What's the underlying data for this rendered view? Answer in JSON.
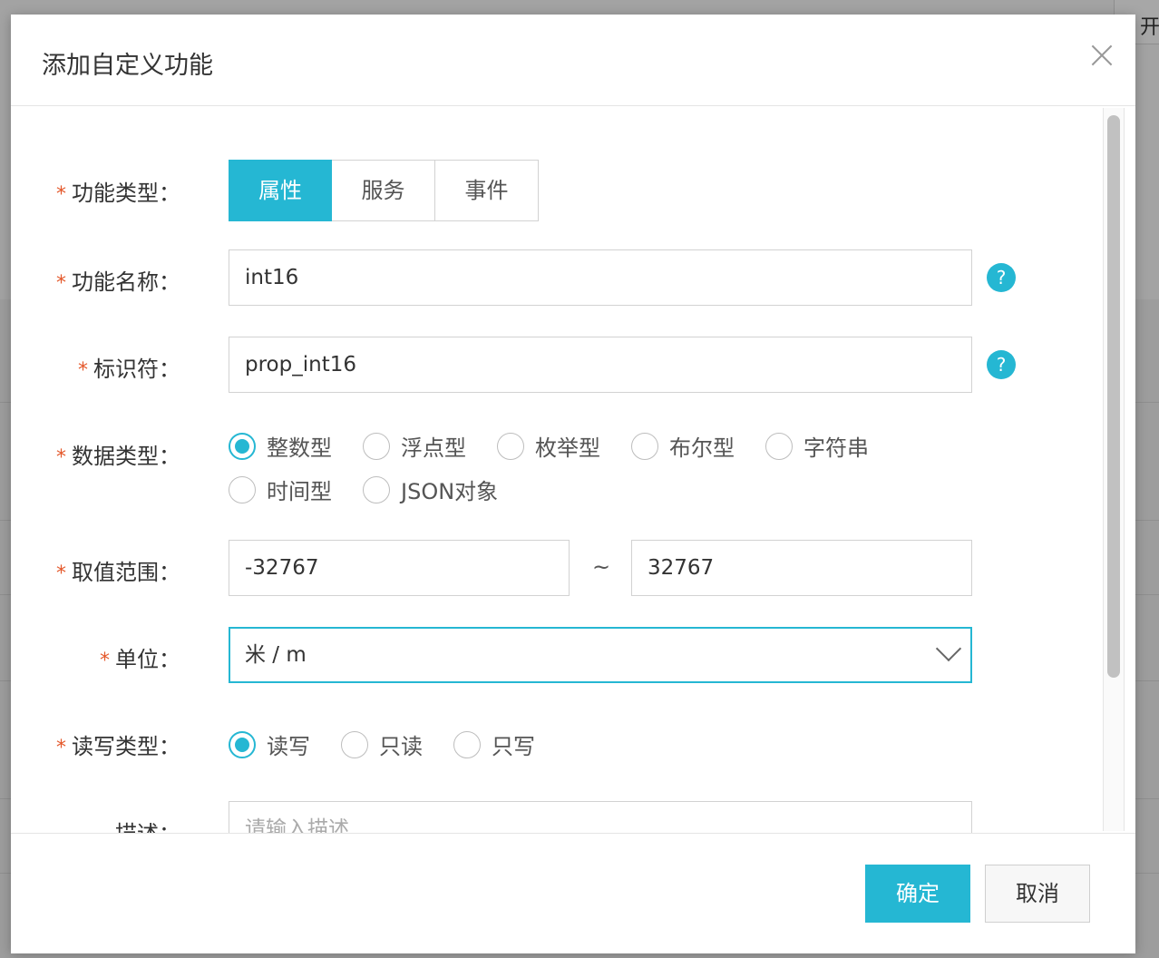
{
  "backdrop": {
    "top_right_text": "开"
  },
  "dialog": {
    "title": "添加自定义功能",
    "required_mark": "*",
    "label_colon": "："
  },
  "form": {
    "function_type": {
      "label": "功能类型",
      "options": [
        "属性",
        "服务",
        "事件"
      ],
      "selected": "属性"
    },
    "function_name": {
      "label": "功能名称",
      "value": "int16",
      "help": "?"
    },
    "identifier": {
      "label": "标识符",
      "value": "prop_int16",
      "help": "?"
    },
    "data_type": {
      "label": "数据类型",
      "options": [
        "整数型",
        "浮点型",
        "枚举型",
        "布尔型",
        "字符串",
        "时间型",
        "JSON对象"
      ],
      "selected": "整数型"
    },
    "value_range": {
      "label": "取值范围",
      "min": "-32767",
      "separator": "~",
      "max": "32767"
    },
    "unit": {
      "label": "单位",
      "value": "米 / m"
    },
    "rw_type": {
      "label": "读写类型",
      "options": [
        "读写",
        "只读",
        "只写"
      ],
      "selected": "读写"
    },
    "description": {
      "label": "描述",
      "placeholder": "请输入描述"
    }
  },
  "footer": {
    "ok_label": "确定",
    "cancel_label": "取消"
  },
  "colors": {
    "accent": "#25b7d3",
    "required": "#e4582b"
  }
}
